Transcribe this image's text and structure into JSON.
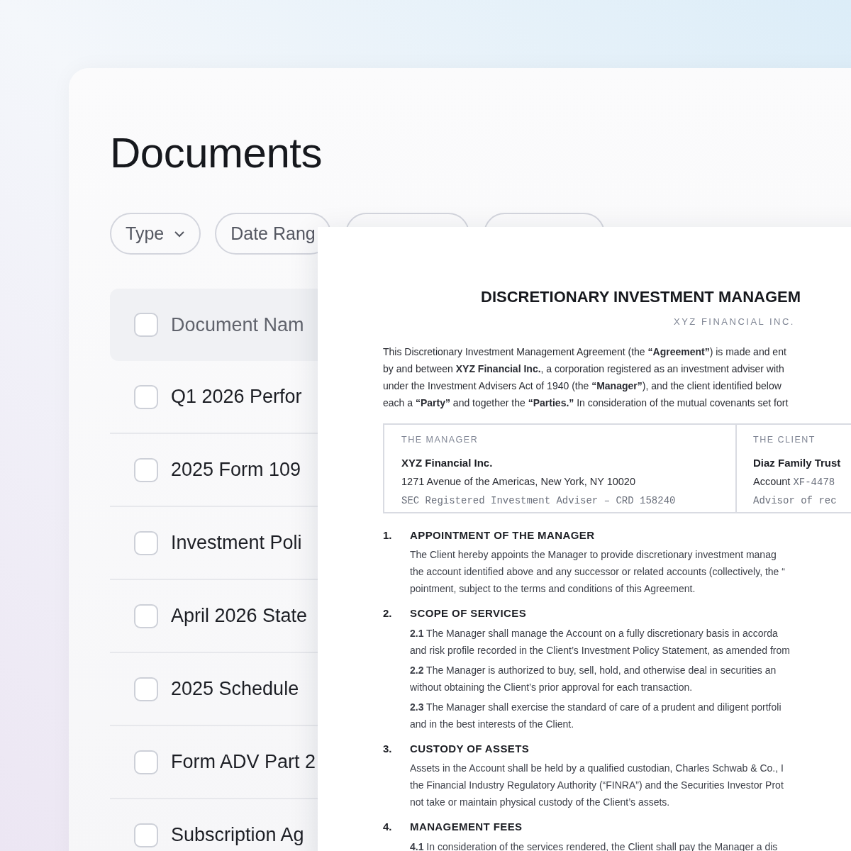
{
  "page": {
    "title": "Documents"
  },
  "filters": [
    {
      "label": "Type",
      "caret": true
    },
    {
      "label": "Date Rang",
      "caret": false
    }
  ],
  "table": {
    "header": {
      "label": "Document Nam",
      "checked": false
    },
    "rows": [
      {
        "name": "Q1 2026 Perfor",
        "checked": false
      },
      {
        "name": "2025 Form 109",
        "checked": false
      },
      {
        "name": "Investment Poli",
        "checked": false
      },
      {
        "name": "April 2026 State",
        "checked": false
      },
      {
        "name": "2025 Schedule",
        "checked": false
      },
      {
        "name": "Form ADV Part 2",
        "checked": false
      },
      {
        "name": "Subscription Ag",
        "checked": false
      }
    ]
  },
  "document": {
    "title": "DISCRETIONARY INVESTMENT MANAGEM",
    "subtitle": "XYZ FINANCIAL INC.",
    "intro_lines": [
      "This Discretionary Investment Management Agreement (the **“Agreement”**) is made and ent",
      "by and between **XYZ Financial Inc.**, a corporation registered as an investment adviser with",
      "under the Investment Advisers Act of 1940 (the **“Manager”**), and the client identified below",
      "each a **“Party”** and together the **“Parties.”** In consideration of the mutual covenants set fort"
    ],
    "parties": [
      {
        "heading": "THE MANAGER",
        "name": "XYZ Financial Inc.",
        "address": "1271 Avenue of the Americas, New York, NY  10020",
        "note": "SEC Registered Investment Adviser – CRD 158240"
      },
      {
        "heading": "THE CLIENT",
        "name": "Diaz Family Trust",
        "account_label": "Account",
        "account_number": "XF-4478",
        "note": "Advisor of rec"
      }
    ],
    "sections": [
      {
        "number": "1.",
        "heading": "APPOINTMENT OF THE MANAGER",
        "clauses": [
          {
            "lines": [
              "The Client hereby appoints the Manager to provide discretionary investment manag",
              "the account identified above and any successor or related accounts (collectively, the “",
              "pointment, subject to the terms and conditions of this Agreement."
            ]
          }
        ]
      },
      {
        "number": "2.",
        "heading": "SCOPE OF SERVICES",
        "clauses": [
          {
            "lines": [
              "**2.1**  The Manager shall manage the Account on a fully discretionary basis in accorda",
              "and risk profile recorded in the Client’s Investment Policy Statement, as amended from"
            ]
          },
          {
            "lines": [
              "**2.2**  The Manager is authorized to buy, sell, hold, and otherwise deal in securities an",
              "without obtaining the Client’s prior approval for each transaction."
            ]
          },
          {
            "lines": [
              "**2.3**  The Manager shall exercise the standard of care of a prudent and diligent portfoli",
              "and in the best interests of the Client."
            ]
          }
        ]
      },
      {
        "number": "3.",
        "heading": "CUSTODY OF ASSETS",
        "clauses": [
          {
            "lines": [
              "Assets in the Account shall be held by a qualified custodian, Charles Schwab & Co., I",
              "the Financial Industry Regulatory Authority (“FINRA”) and the Securities Investor Prot",
              "not take or maintain physical custody of the Client’s assets."
            ]
          }
        ]
      },
      {
        "number": "4.",
        "heading": "MANAGEMENT FEES",
        "clauses": [
          {
            "lines": [
              "**4.1**  In consideration of the services rendered, the Client shall pay the Manager a dis"
            ]
          }
        ]
      }
    ]
  }
}
